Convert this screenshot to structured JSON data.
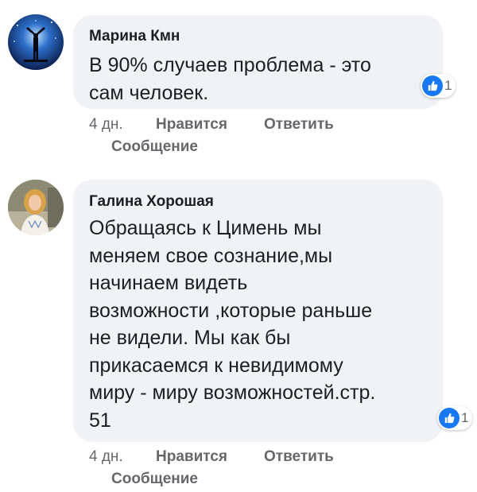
{
  "comments": [
    {
      "author": "Марина Кмн",
      "text": "В 90% случаев проблема - это\nсам человек.",
      "reaction_count": "1",
      "time": "4 дн.",
      "like_label": "Нравится",
      "reply_label": "Ответить",
      "message_label": "Сообщение"
    },
    {
      "author": "Галина Хорошая",
      "text": "Обращаясь к Цимень мы\nменяем свое сознание,мы\nначинаем видеть\nвозможности ,которые раньше\nне видели. Мы как бы\nприкасаемся к невидимому\nмиру - миру возможностей.стр.\n51",
      "reaction_count": "1",
      "time": "4 дн.",
      "like_label": "Нравится",
      "reply_label": "Ответить",
      "message_label": "Сообщение"
    }
  ],
  "colors": {
    "bubble": "#f0f2f5",
    "like_blue": "#1877f2",
    "secondary_text": "#65676b"
  },
  "icons": [
    "avatar-space-silhouette",
    "avatar-woman-photo",
    "like-icon"
  ]
}
